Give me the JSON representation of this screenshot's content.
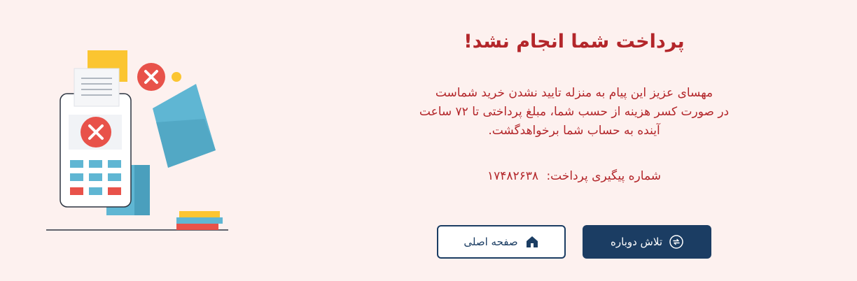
{
  "title": "پرداخت شما انجام نشد!",
  "message": {
    "line1": "مهسای عزیز این پیام به منزله تایید نشدن خرید شماست",
    "line2": "در صورت کسر هزینه از حسب شما، مبلغ پرداختی تا ۷۲ ساعت",
    "line3": "آینده به حساب شما برخواهدگشت."
  },
  "tracking": {
    "label": "شماره پیگیری پرداخت:",
    "value": "۱۷۴۸۲۶۳۸"
  },
  "buttons": {
    "retry": {
      "label": "تلاش دوباره",
      "icon": "refresh-icon"
    },
    "home": {
      "label": "صفحه اصلی",
      "icon": "home-icon"
    }
  },
  "colors": {
    "background": "#fdf1ef",
    "error_text": "#b3262a",
    "primary": "#1b3d63"
  }
}
